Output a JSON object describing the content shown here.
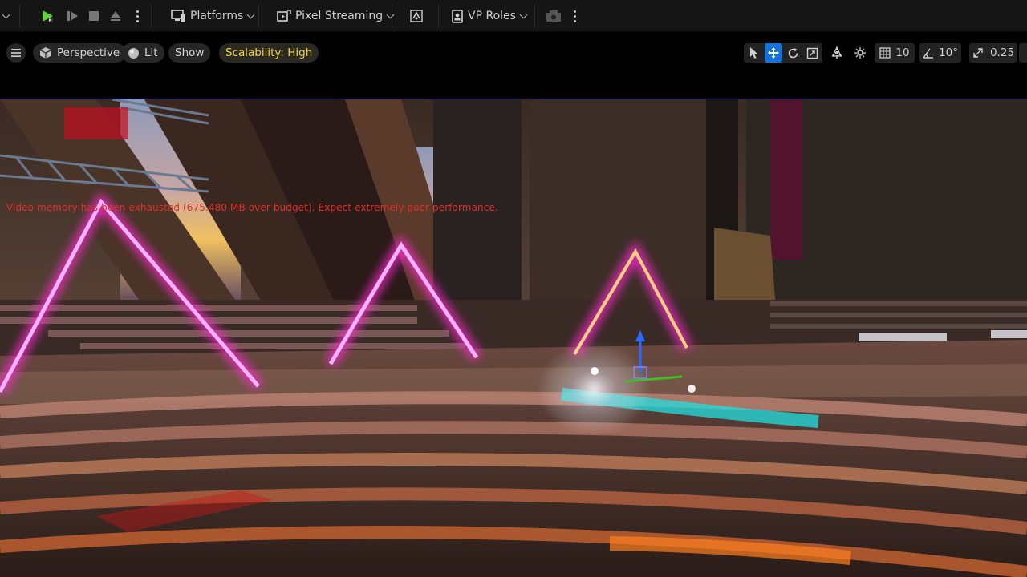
{
  "toolbar": {
    "platforms_label": "Platforms",
    "pixel_streaming_label": "Pixel Streaming",
    "vp_roles_label": "VP Roles"
  },
  "viewport": {
    "perspective_label": "Perspective",
    "lit_label": "Lit",
    "show_label": "Show",
    "scalability_label": "Scalability: High",
    "grid_snap_value": "10",
    "rotation_snap_value": "10°",
    "scale_snap_value": "0.25",
    "warning_text": "Video memory has been exhausted (675.480 MB over budget). Expect extremely poor performance."
  },
  "colors": {
    "neon": "#ff2cd0",
    "active_tool": "#1473d9",
    "scalability_text": "#f0d040",
    "warning_text": "#e0302a"
  }
}
